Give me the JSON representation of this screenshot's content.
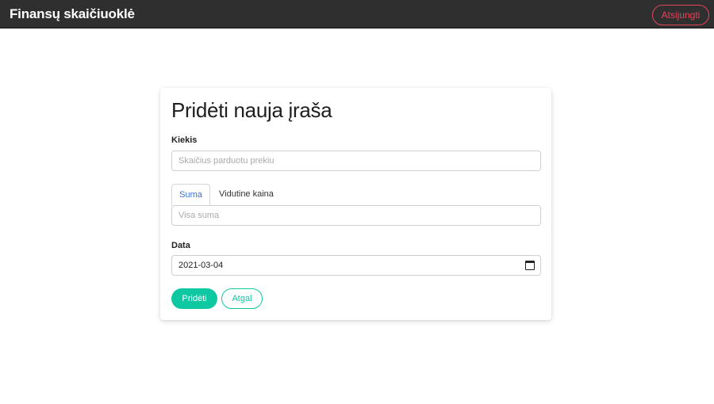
{
  "header": {
    "brand": "Finansų skaičiuoklė",
    "logout_label": "Atsijungti"
  },
  "form": {
    "title": "Pridėti nauja įraša",
    "quantity": {
      "label": "Kiekis",
      "placeholder": "Skaičius parduotu prekiu",
      "value": ""
    },
    "tabs": [
      {
        "label": "Suma",
        "active": true
      },
      {
        "label": "Vidutine kaina",
        "active": false
      }
    ],
    "amount": {
      "placeholder": "Visa suma",
      "value": ""
    },
    "date": {
      "label": "Data",
      "value": "2021-03-04",
      "icon": "calendar-icon"
    },
    "submit_label": "Pridėti",
    "back_label": "Atgal"
  },
  "colors": {
    "navbar": "#2f2f2f",
    "accent": "#0ec8a2",
    "danger": "#e0465a",
    "active_tab": "#3b6fd6"
  }
}
